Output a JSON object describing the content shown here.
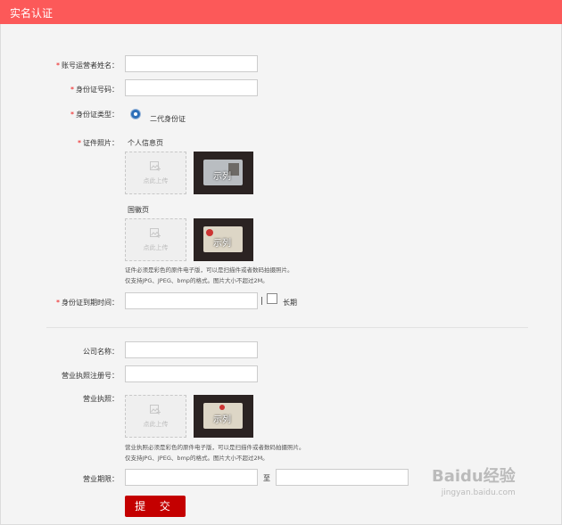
{
  "header": {
    "title": "实名认证"
  },
  "form": {
    "operator_name_label": "账号运营者姓名：",
    "id_number_label": "身份证号码：",
    "id_type_label": "身份证类型：",
    "id_type_option": "二代身份证",
    "id_photo_label": "证件照片：",
    "front_label": "个人信息页",
    "back_label": "国徽页",
    "upload_text": "点此上传",
    "sample_text": "示列",
    "photo_note_1": "证件必须是彩色的原件电子版，可以是扫描件或者数码拍摄照片。",
    "photo_note_2": "仅支持JPG、JPEG、bmp的格式。图片大小不超过2M。",
    "expiry_label": "身份证到期时间：",
    "separator": "|",
    "long_term_label": "长期",
    "company_name_label": "公司名称：",
    "license_reg_label": "营业执照注册号：",
    "license_label": "营业执照：",
    "license_note_1": "营业执照必须是彩色的原件电子版，可以是扫描件或者数码拍摄照片。",
    "license_note_2": "仅支持JPG、JPEG、bmp的格式。图片大小不超过2M。",
    "period_label": "营业期限：",
    "period_to": "至",
    "submit_label": "提 交"
  },
  "watermark": {
    "brand": "Baidu经验",
    "url": "jingyan.baidu.com"
  }
}
